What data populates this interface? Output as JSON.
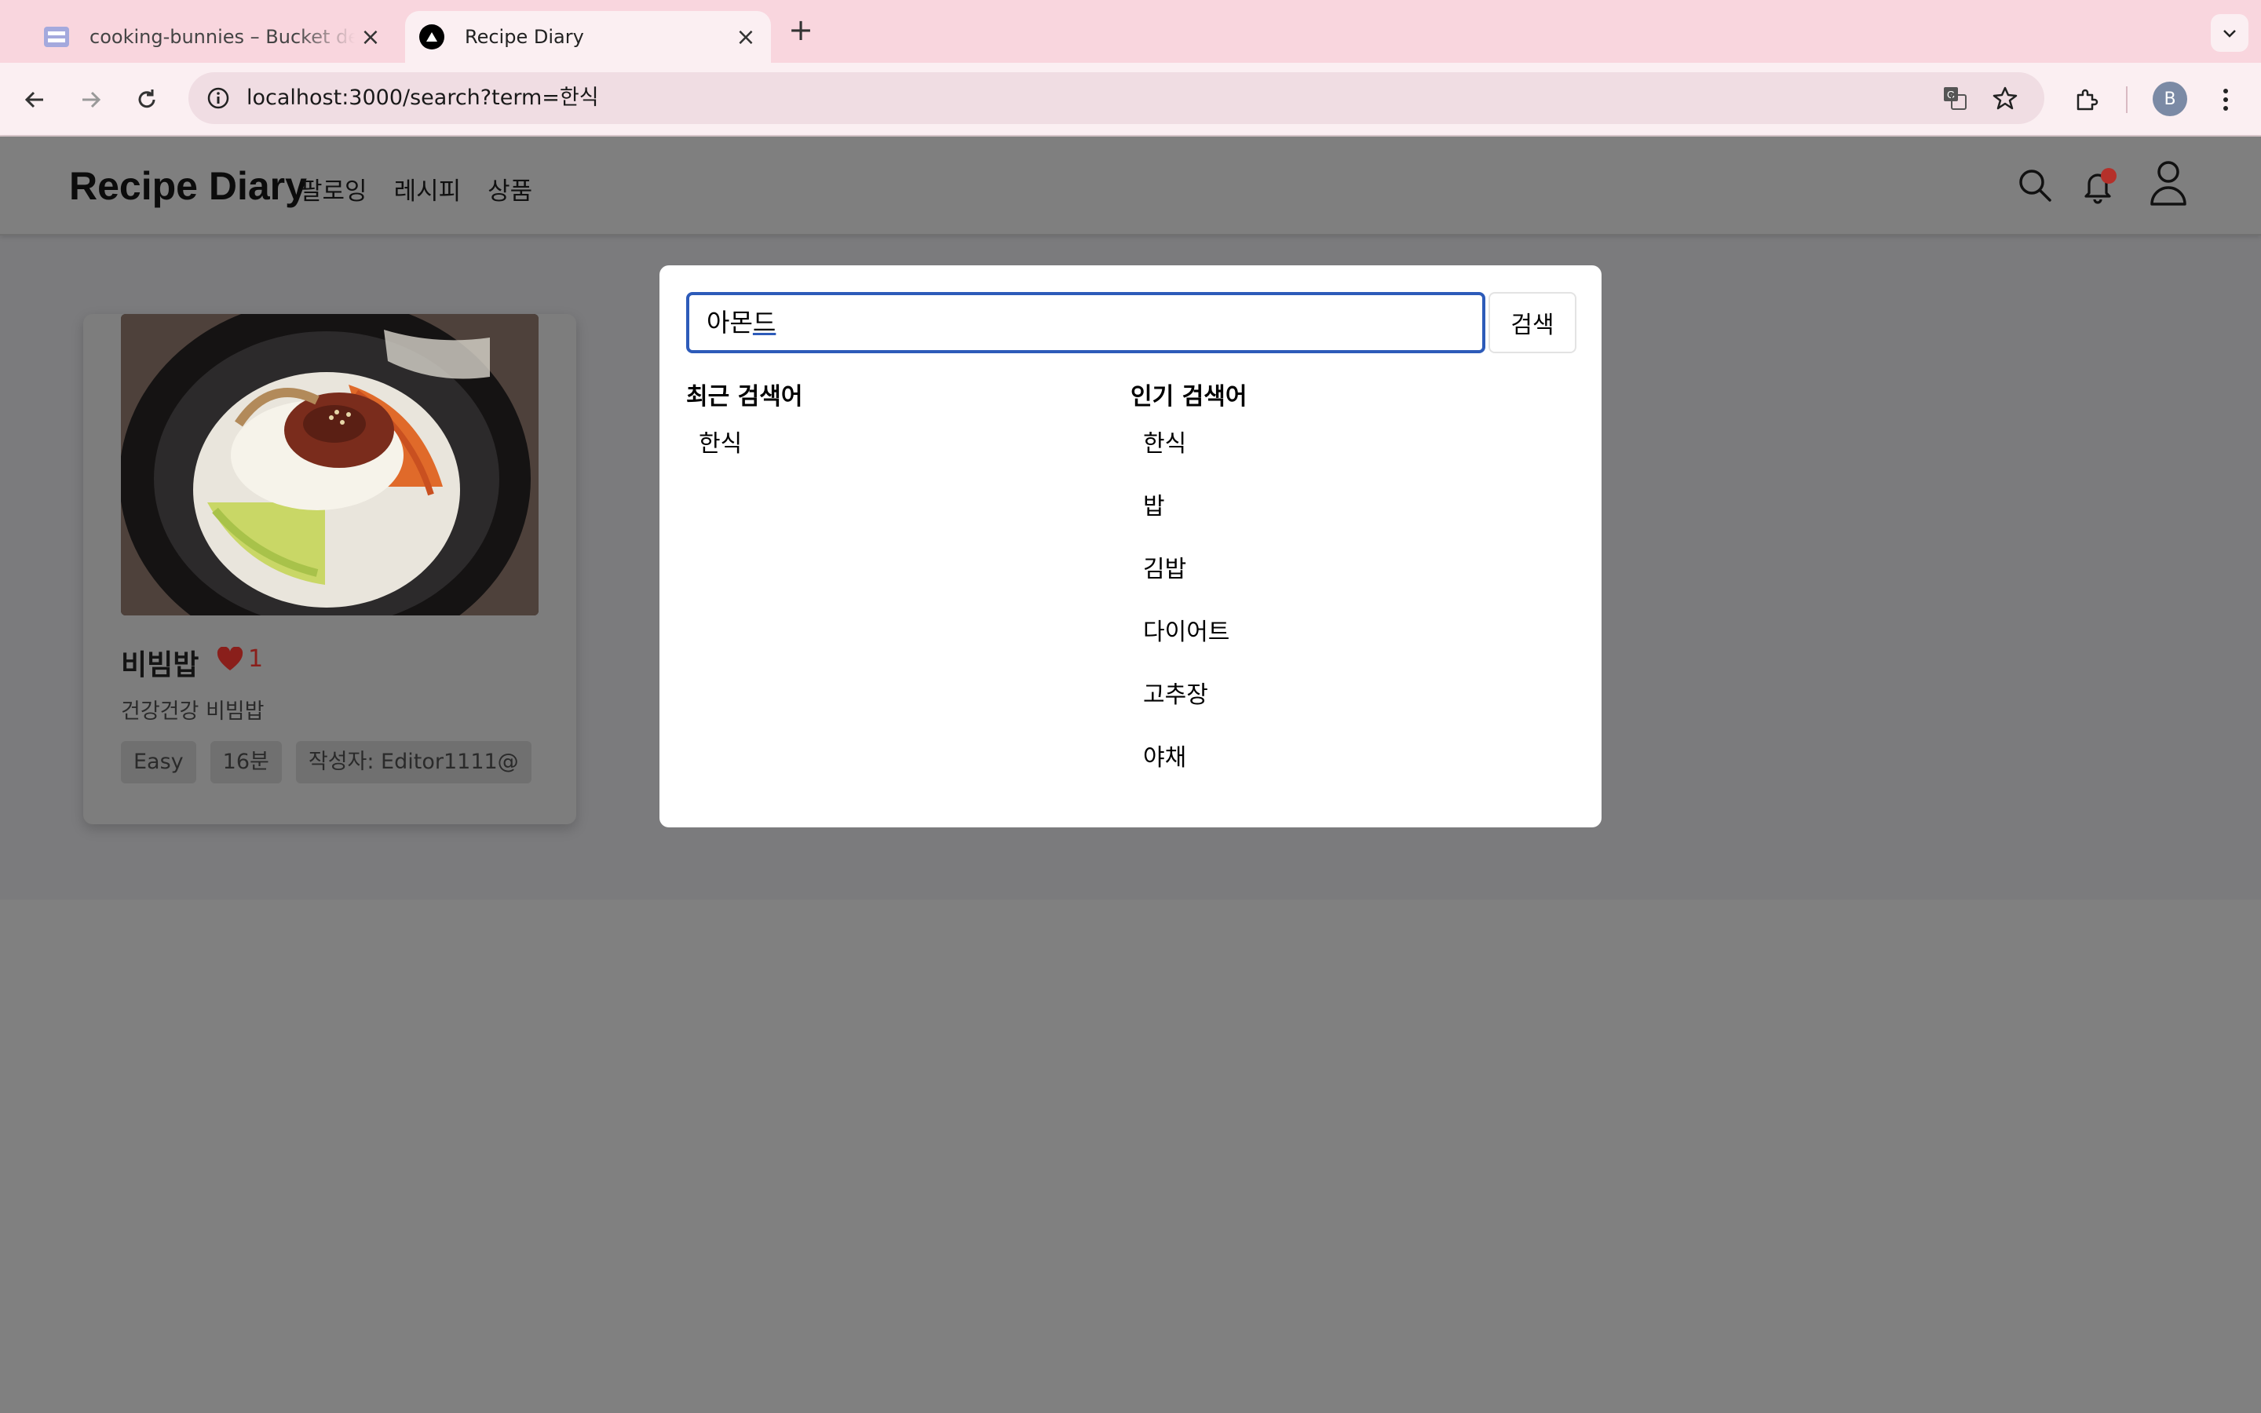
{
  "browser": {
    "tabs": [
      {
        "title": "cooking-bunnies – Bucket de",
        "active": false
      },
      {
        "title": "Recipe Diary",
        "active": true
      }
    ],
    "url": "localhost:3000/search?term=한식",
    "profile_initial": "B"
  },
  "header": {
    "logo": "Recipe Diary",
    "nav": [
      "팔로잉",
      "레시피",
      "상품"
    ]
  },
  "recipe_card": {
    "title": "비빔밥",
    "likes": "1",
    "description": "건강건강 비빔밥",
    "tags": [
      "Easy",
      "16분",
      "작성자: Editor1111@"
    ]
  },
  "search_modal": {
    "input_value": "아몬드",
    "input_composed_prefix": "아몬",
    "input_composing_char": "드",
    "button_label": "검색",
    "recent_title": "최근 검색어",
    "recent": [
      "한식"
    ],
    "popular_title": "인기 검색어",
    "popular": [
      "한식",
      "밥",
      "김밥",
      "다이어트",
      "고추장",
      "야채"
    ]
  },
  "colors": {
    "tabstrip": "#f9d6de",
    "toolbar": "#fbeff2",
    "overlay_bg": "#808080",
    "focus_ring": "#2d5bb9",
    "like": "#8a1f1b"
  }
}
